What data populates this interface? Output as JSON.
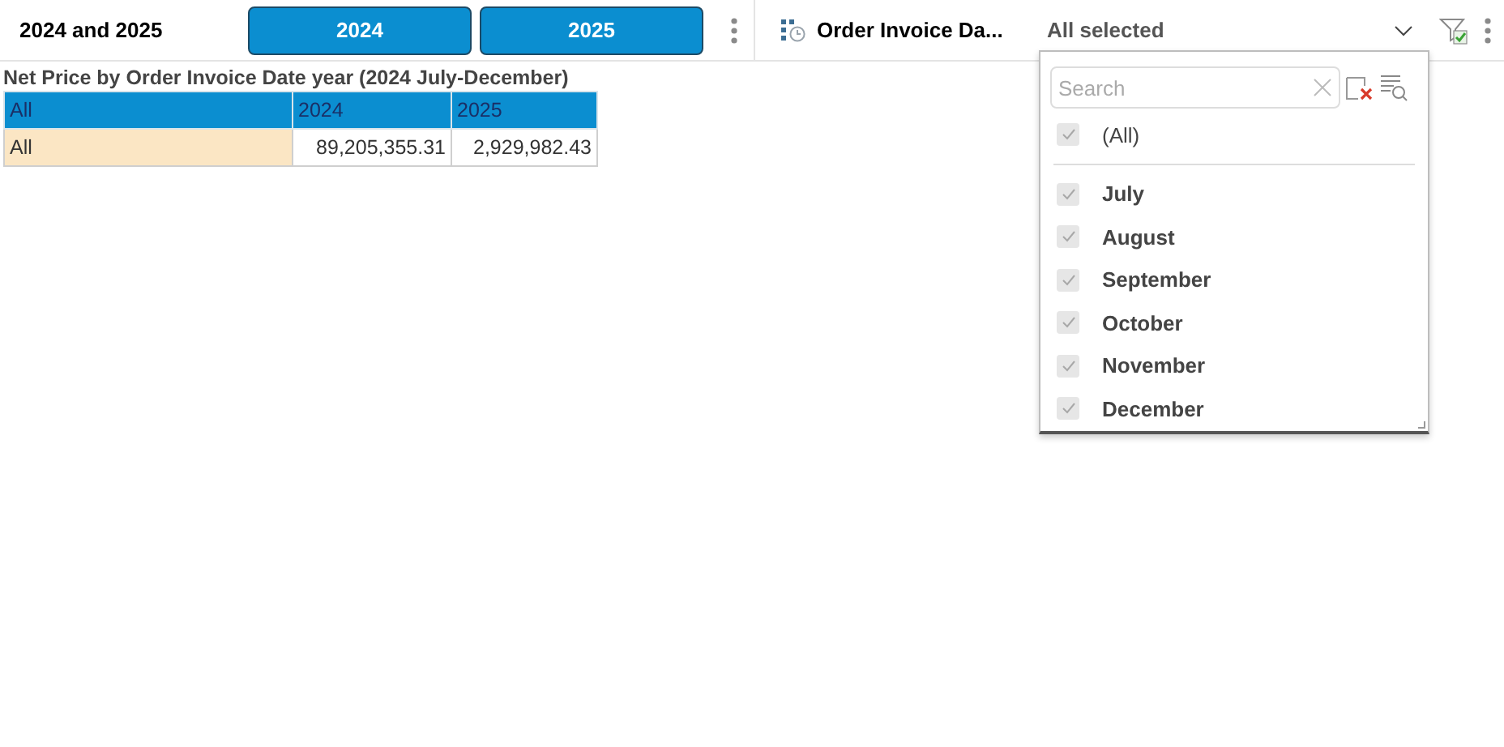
{
  "year_slicer": {
    "title": "2024 and 2025",
    "buttons": [
      {
        "label": "2024",
        "selected": true
      },
      {
        "label": "2025",
        "selected": true
      }
    ]
  },
  "date_filter": {
    "label": "Order Invoice Da...",
    "value": "All selected",
    "expanded": true,
    "dropdown": {
      "search": {
        "placeholder": "Search"
      },
      "all": {
        "label": "(All)",
        "checked": true
      },
      "items": [
        {
          "label": "July",
          "checked": true
        },
        {
          "label": "August",
          "checked": true
        },
        {
          "label": "September",
          "checked": true
        },
        {
          "label": "October",
          "checked": true
        },
        {
          "label": "November",
          "checked": true
        },
        {
          "label": "December",
          "checked": true
        }
      ]
    }
  },
  "table": {
    "title": "Net Price by Order Invoice Date year (2024 July-December)",
    "columns": [
      "All",
      "2024",
      "2025"
    ],
    "rows": [
      [
        "All",
        "89,205,355.31",
        "2,929,982.43"
      ]
    ]
  }
}
